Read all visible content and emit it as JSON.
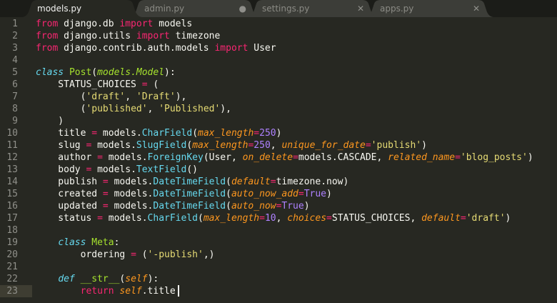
{
  "tabs": [
    {
      "label": "models.py",
      "state": "active",
      "control": "",
      "control_icon": ""
    },
    {
      "label": "admin.py",
      "state": "modified",
      "control": "●",
      "control_icon": "modified-dot-icon"
    },
    {
      "label": "settings.py",
      "state": "inactive",
      "control": "✕",
      "control_icon": "close-icon"
    },
    {
      "label": "apps.py",
      "state": "inactive",
      "control": "✕",
      "control_icon": "close-icon"
    }
  ],
  "editor": {
    "current_line": 23,
    "lines": [
      {
        "n": "1",
        "t": "from django.db import models"
      },
      {
        "n": "2",
        "t": "from django.utils import timezone"
      },
      {
        "n": "3",
        "t": "from django.contrib.auth.models import User"
      },
      {
        "n": "4",
        "t": ""
      },
      {
        "n": "5",
        "t": "class Post(models.Model):"
      },
      {
        "n": "6",
        "t": "    STATUS_CHOICES = ("
      },
      {
        "n": "7",
        "t": "        ('draft', 'Draft'),"
      },
      {
        "n": "8",
        "t": "        ('published', 'Published'),"
      },
      {
        "n": "9",
        "t": "    )"
      },
      {
        "n": "10",
        "t": "    title = models.CharField(max_length=250)"
      },
      {
        "n": "11",
        "t": "    slug = models.SlugField(max_length=250, unique_for_date='publish')"
      },
      {
        "n": "12",
        "t": "    author = models.ForeignKey(User, on_delete=models.CASCADE, related_name='blog_posts')"
      },
      {
        "n": "13",
        "t": "    body = models.TextField()"
      },
      {
        "n": "14",
        "t": "    publish = models.DateTimeField(default=timezone.now)"
      },
      {
        "n": "15",
        "t": "    created = models.DateTimeField(auto_now_add=True)"
      },
      {
        "n": "16",
        "t": "    updated = models.DateTimeField(auto_now=True)"
      },
      {
        "n": "17",
        "t": "    status = models.CharField(max_length=10, choices=STATUS_CHOICES, default='draft')"
      },
      {
        "n": "18",
        "t": ""
      },
      {
        "n": "19",
        "t": "    class Meta:"
      },
      {
        "n": "20",
        "t": "        ordering = ('-publish',)"
      },
      {
        "n": "21",
        "t": ""
      },
      {
        "n": "22",
        "t": "    def __str__(self):"
      },
      {
        "n": "23",
        "t": "        return self.title"
      }
    ]
  },
  "colors": {
    "background": "#272822",
    "tab_active": "#272822",
    "tab_inactive": "#3c3d38",
    "keyword": "#f92672",
    "function": "#66d9ef",
    "argument": "#fd971f",
    "string": "#e6db74",
    "number": "#ae81ff",
    "class_name": "#a6e22e"
  }
}
